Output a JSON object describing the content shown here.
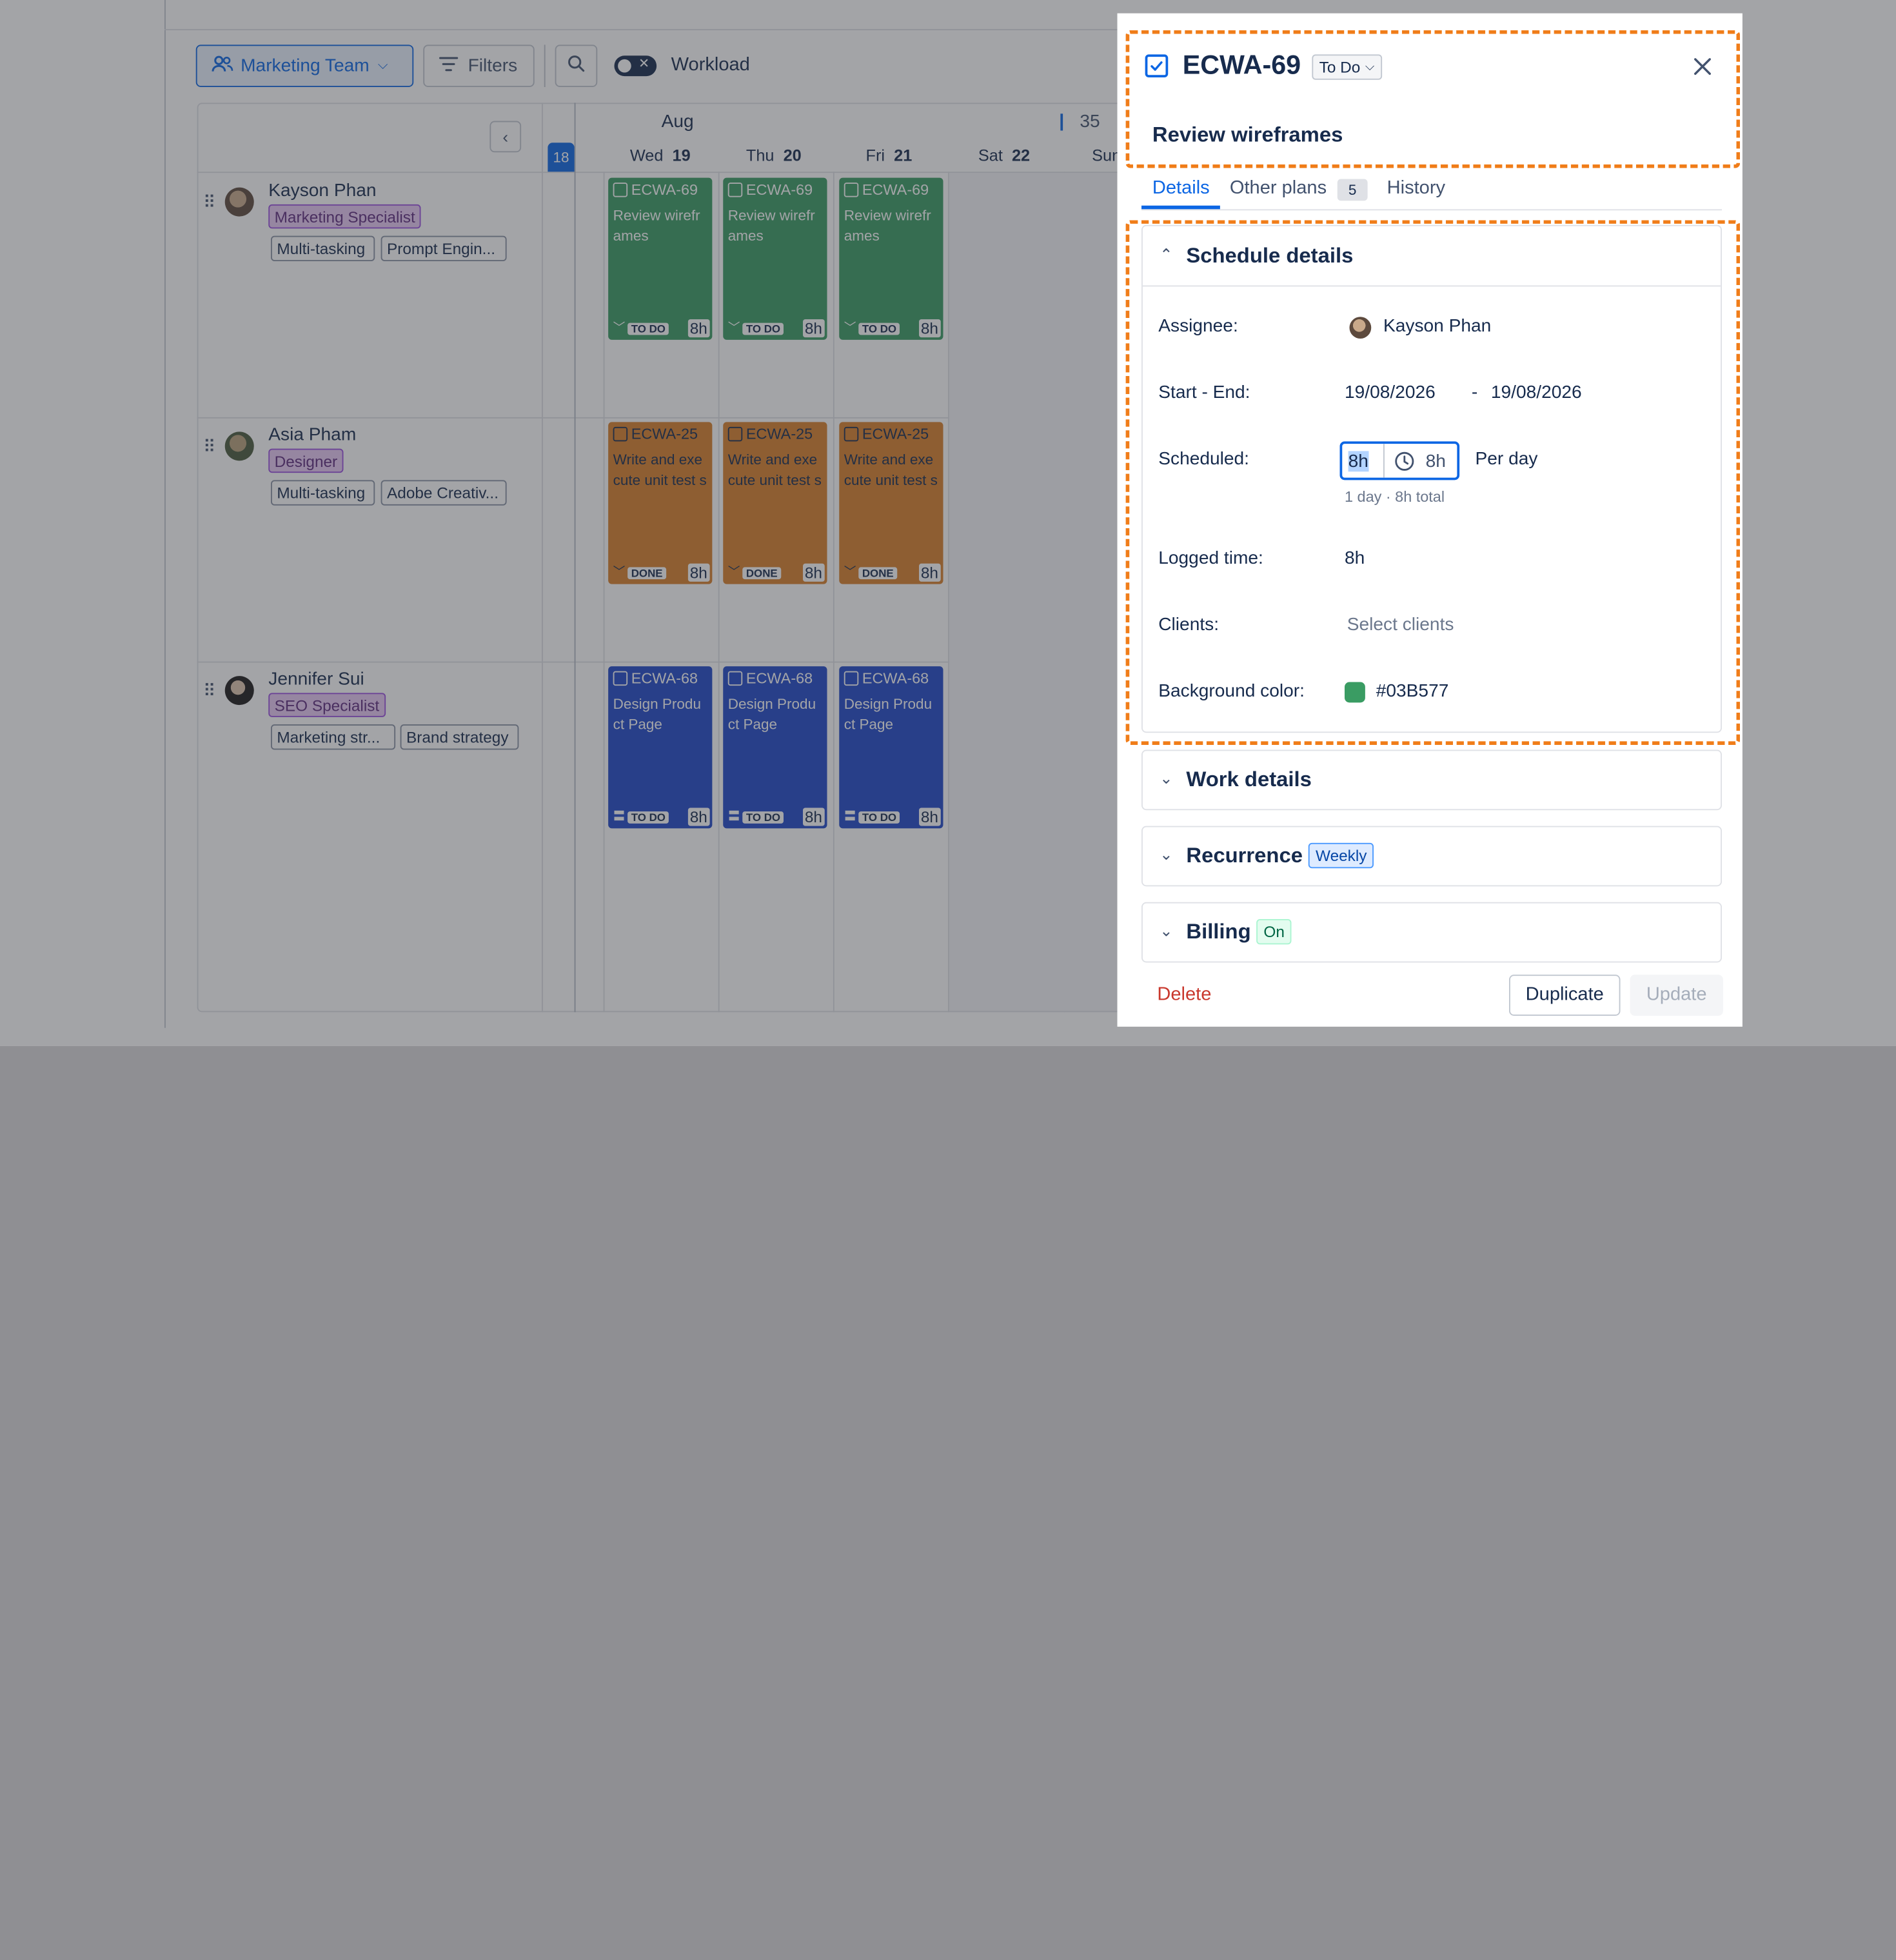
{
  "toolbar": {
    "team_label": "Marketing Team",
    "filters_label": "Filters",
    "workload_label": "Workload"
  },
  "calendar": {
    "month": "Aug",
    "week_number": "35",
    "today_day": "18",
    "days": [
      {
        "name": "Wed",
        "num": "19"
      },
      {
        "name": "Thu",
        "num": "20"
      },
      {
        "name": "Fri",
        "num": "21"
      },
      {
        "name": "Sat",
        "num": "22"
      },
      {
        "name": "Sun",
        "num": ""
      }
    ]
  },
  "people": [
    {
      "name": "Kayson Phan",
      "role": "Marketing Specialist",
      "tags": [
        "Multi-tasking",
        "Prompt Engin..."
      ]
    },
    {
      "name": "Asia Pham",
      "role": "Designer",
      "tags": [
        "Multi-tasking",
        "Adobe Creativ..."
      ]
    },
    {
      "name": "Jennifer Sui",
      "role": "SEO Specialist",
      "tags": [
        "Marketing str...",
        "Brand strategy"
      ]
    }
  ],
  "tasks": [
    {
      "id": "ECWA-69",
      "title": "Review wirefr ames",
      "status": "TO DO",
      "hours": "8h",
      "color": "#3a9c63"
    },
    {
      "id": "ECWA-25",
      "title": "Write and exe cute unit test s",
      "status": "DONE",
      "hours": "8h",
      "color": "#d9802b"
    },
    {
      "id": "ECWA-68",
      "title": "Design Produ ct Page",
      "status": "TO DO",
      "hours": "8h",
      "color": "#2048c9"
    }
  ],
  "panel": {
    "issue_key": "ECWA-69",
    "status": "To Do",
    "title": "Review wireframes",
    "tabs": {
      "details": "Details",
      "other_plans": "Other plans",
      "other_plans_count": "5",
      "history": "History"
    },
    "schedule": {
      "heading": "Schedule details",
      "assignee_label": "Assignee:",
      "assignee": "Kayson Phan",
      "start_end_label": "Start - End:",
      "start": "19/08/2026",
      "dash": "-",
      "end": "19/08/2026",
      "scheduled_label": "Scheduled:",
      "scheduled_value": "8h",
      "scheduled_total": "8h",
      "per_day": "Per day",
      "summary": "1 day · 8h total",
      "logged_label": "Logged time:",
      "logged": "8h",
      "clients_label": "Clients:",
      "clients_placeholder": "Select clients",
      "bg_label": "Background color:",
      "bg_value": "#03B577"
    },
    "work_details": "Work details",
    "recurrence": "Recurrence",
    "recurrence_badge": "Weekly",
    "billing": "Billing",
    "billing_badge": "On",
    "delete": "Delete",
    "duplicate": "Duplicate",
    "update": "Update"
  },
  "colors": {
    "accent": "#0c66e4",
    "highlight": "#f07d19",
    "bg_swatch": "#03B577"
  }
}
